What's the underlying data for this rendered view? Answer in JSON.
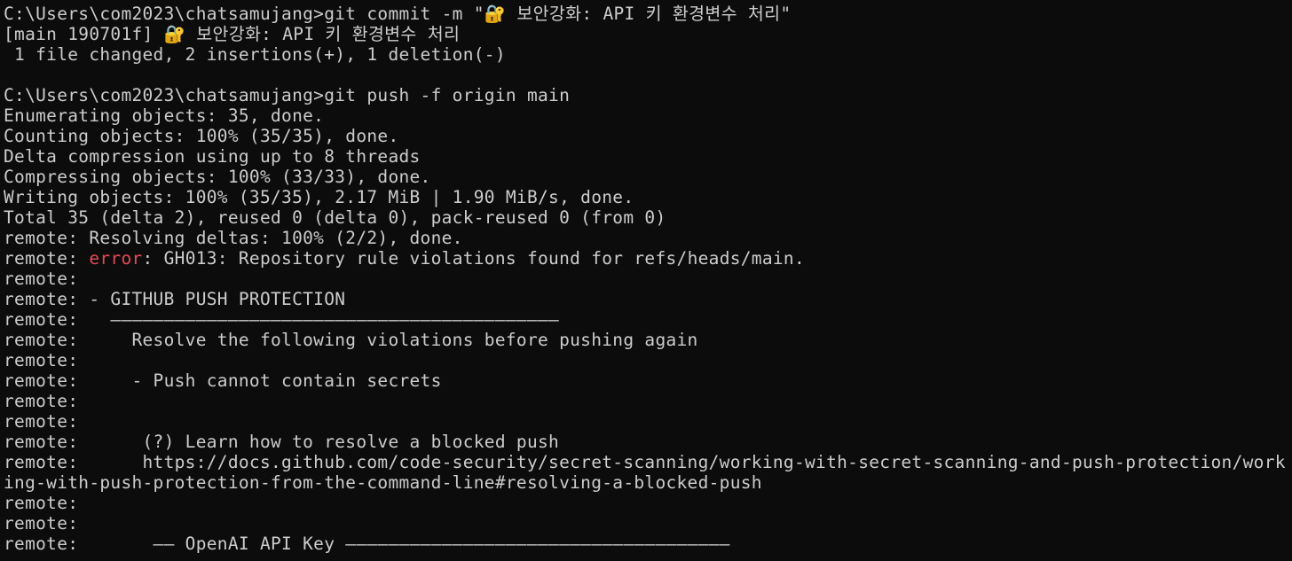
{
  "terminal": {
    "lines": [
      "C:\\Users\\com2023\\chatsamujang>git commit -m \"🔐 보안강화: API 키 환경변수 처리\"",
      "[main 190701f] 🔐 보안강화: API 키 환경변수 처리",
      " 1 file changed, 2 insertions(+), 1 deletion(-)",
      "",
      "C:\\Users\\com2023\\chatsamujang>git push -f origin main",
      "Enumerating objects: 35, done.",
      "Counting objects: 100% (35/35), done.",
      "Delta compression using up to 8 threads",
      "Compressing objects: 100% (33/33), done.",
      "Writing objects: 100% (35/35), 2.17 MiB | 1.90 MiB/s, done.",
      "Total 35 (delta 2), reused 0 (delta 0), pack-reused 0 (from 0)",
      "remote: Resolving deltas: 100% (2/2), done.",
      {
        "prefix": "remote: ",
        "error_word": "error",
        "suffix": ": GH013: Repository rule violations found for refs/heads/main."
      },
      "remote:",
      "remote: - GITHUB PUSH PROTECTION",
      "remote:   ——————————————————————————————————————————",
      "remote:     Resolve the following violations before pushing again",
      "remote:",
      "remote:     - Push cannot contain secrets",
      "remote:",
      "remote:",
      "remote:      (?) Learn how to resolve a blocked push",
      "remote:      https://docs.github.com/code-security/secret-scanning/working-with-secret-scanning-and-push-protection/work",
      "ing-with-push-protection-from-the-command-line#resolving-a-blocked-push",
      "remote:",
      "remote:",
      "remote:       —— OpenAI API Key ————————————————————————————————————"
    ]
  },
  "colors": {
    "background": "#0c0c0c",
    "foreground": "#cccccc",
    "error": "#e74856"
  }
}
